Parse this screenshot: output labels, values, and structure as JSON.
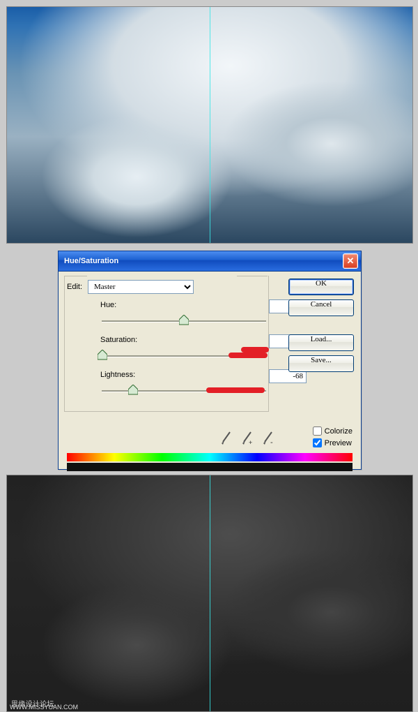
{
  "dialog": {
    "title": "Hue/Saturation",
    "edit_label": "Edit:",
    "edit_value": "Master",
    "hue": {
      "label": "Hue:",
      "value": "0"
    },
    "saturation": {
      "label": "Saturation:",
      "value": "-100"
    },
    "lightness": {
      "label": "Lightness:",
      "value": "-68"
    },
    "buttons": {
      "ok": "OK",
      "cancel": "Cancel",
      "load": "Load...",
      "save": "Save..."
    },
    "colorize_label": "Colorize",
    "preview_label": "Preview",
    "colorize_checked": false,
    "preview_checked": true
  },
  "watermark": "思缘设计论坛",
  "watermark_url": "WWW.MISSYUAN.COM"
}
